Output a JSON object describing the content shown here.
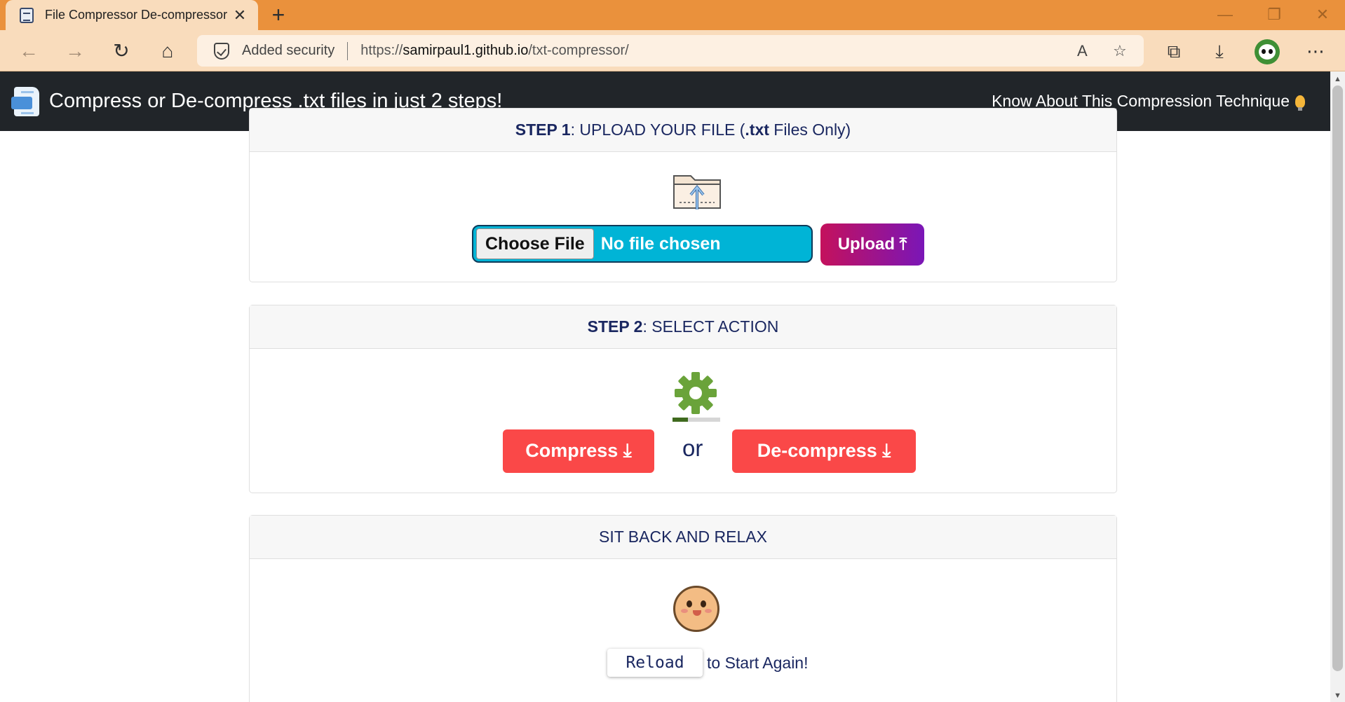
{
  "browser": {
    "tab_title": "File Compressor De-compressor",
    "tab_close": "✕",
    "new_tab": "+",
    "security_label": "Added security",
    "url_prefix": "https://",
    "url_host": "samirpaul1.github.io",
    "url_path": "/txt-compressor/",
    "icons": [
      "back-icon",
      "forward-icon",
      "refresh-icon",
      "home-icon",
      "read-aloud-icon",
      "favorites-icon",
      "extensions-icon",
      "downloads-icon",
      "profile-avatar",
      "more-icon"
    ]
  },
  "navbar": {
    "title": "Compress or De-compress .txt files in just 2 steps!",
    "link": "Know About This Compression Technique"
  },
  "step1": {
    "head_bold": "STEP 1",
    "head_mid": ": UPLOAD YOUR FILE (",
    "head_ext": ".txt",
    "head_end": " Files Only)",
    "choose_label": "Choose File",
    "file_status": "No file chosen",
    "upload_label": "Upload ⤒"
  },
  "step2": {
    "head_bold": "STEP 2",
    "head_rest": ": SELECT ACTION",
    "progress": 0.33,
    "compress_label": "Compress ⤓",
    "or_label": "or",
    "decompress_label": "De-compress ⤓"
  },
  "step3": {
    "head": "SIT BACK AND RELAX",
    "reload_label": "Reload",
    "reload_text": "to Start Again!"
  },
  "colors": {
    "tabbar": "#ea913c",
    "navbar": "#212529",
    "file_input": "#00b4d6",
    "action_button": "#fa4848",
    "heading_text": "#1a2760"
  }
}
